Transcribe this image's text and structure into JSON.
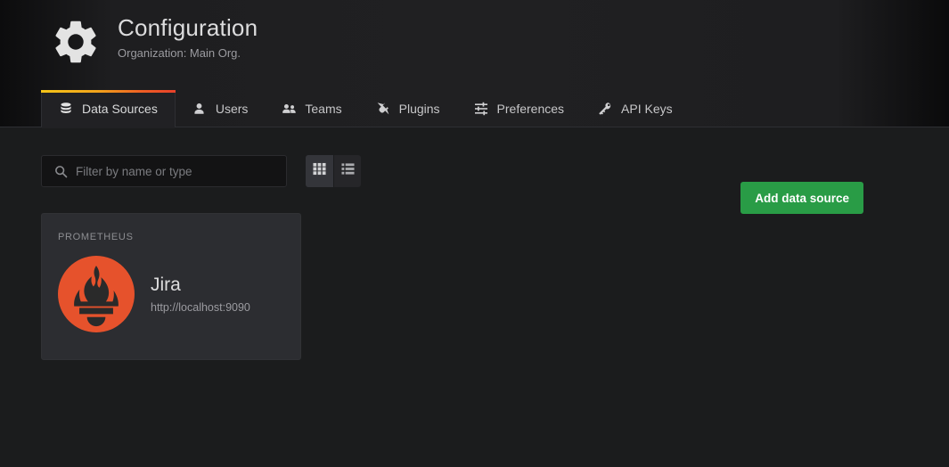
{
  "header": {
    "icon": "gear-icon",
    "title": "Configuration",
    "subtitle": "Organization: Main Org."
  },
  "tabs": [
    {
      "label": "Data Sources",
      "icon": "database-icon",
      "active": true
    },
    {
      "label": "Users",
      "icon": "user-icon",
      "active": false
    },
    {
      "label": "Teams",
      "icon": "users-icon",
      "active": false
    },
    {
      "label": "Plugins",
      "icon": "plugin-icon",
      "active": false
    },
    {
      "label": "Preferences",
      "icon": "sliders-icon",
      "active": false
    },
    {
      "label": "API Keys",
      "icon": "key-icon",
      "active": false
    }
  ],
  "toolbar": {
    "search_placeholder": "Filter by name or type",
    "search_value": "",
    "search_icon": "search-icon",
    "view_grid": "grid-view-icon",
    "view_list": "list-view-icon",
    "active_view": "grid",
    "add_label": "Add data source"
  },
  "datasources": [
    {
      "type": "PROMETHEUS",
      "name": "Jira",
      "url": "http://localhost:9090",
      "logo": "prometheus-logo"
    }
  ],
  "colors": {
    "accent_green": "#299c46",
    "prometheus_orange": "#e6522c",
    "tab_gradient_start": "#f5c518",
    "tab_gradient_end": "#e8412a",
    "page_background": "#1b1c1d",
    "card_background": "#2c2d31"
  }
}
